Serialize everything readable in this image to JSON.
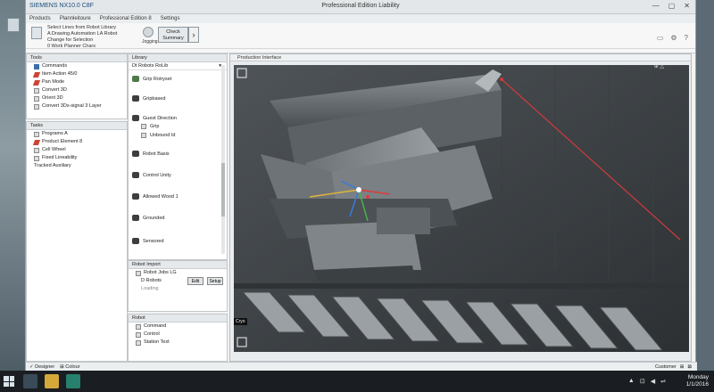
{
  "desktop": {
    "bezel_icon": "monitor-icon"
  },
  "window": {
    "brand": "SIEMENS NX10.0  C8F",
    "title": "Professional Edition Liability",
    "controls": [
      "—",
      "▢",
      "✕"
    ]
  },
  "menubar": {
    "items": [
      "Products",
      "Plannleitoure",
      "Professional Edition 8",
      "Settings"
    ]
  },
  "ribbon": {
    "lines": [
      "Select Lines from Robot Library",
      "A Drawing Automation LA Robot",
      "Change for Selection",
      "0 Work Planner Chars"
    ],
    "tool_label": "Jogging",
    "check_label_1": "Check",
    "check_label_2": "Summary",
    "arrow": "›",
    "right_icons": [
      "▭",
      "⚙",
      "?"
    ]
  },
  "tools": {
    "title": "Tools",
    "items": [
      {
        "label": "Commands",
        "icon": "blue"
      },
      {
        "label": "Item Action 45/0",
        "icon": "red"
      },
      {
        "label": "Pan Mode",
        "icon": "red"
      },
      {
        "label": "Convert 3D",
        "icon": "none"
      },
      {
        "label": "Orient 3D",
        "icon": "none"
      },
      {
        "label": "Convert 3Ds-signal 3 Layer",
        "icon": "none"
      }
    ]
  },
  "tasks": {
    "title": "Tasks",
    "items": [
      {
        "label": "Programs A",
        "icon": "folder"
      },
      {
        "label": "Product Element 8",
        "icon": "red"
      },
      {
        "label": "Cell Wheel",
        "icon": "box"
      },
      {
        "label": "Fixed Lineability",
        "icon": "box"
      },
      {
        "label": "Tracked Auxiliary",
        "icon": "none"
      }
    ]
  },
  "library": {
    "title": "Library",
    "tabs": [
      "Dt Robots RoLib",
      "▾"
    ],
    "items": [
      "Grip Rotryset",
      "Gripbased",
      "Guest Direction",
      "Grip",
      "Unbound Id",
      "Robot Basis",
      "Control Unity",
      "Allowed Wood 1",
      "Grounded",
      "Sensored"
    ]
  },
  "object": {
    "title": "Robot Import",
    "items": [
      "Robot Jobs LG",
      "D Robots",
      "Loading"
    ],
    "btn_edit": "Edit",
    "btn_setup": "Setup"
  },
  "props": {
    "title": "Robot",
    "items": [
      "Command",
      "Control",
      "Station Text"
    ]
  },
  "viewport": {
    "title": "Production Interface",
    "tag": "Cryo",
    "coord_readout": "⊕ △"
  },
  "status": {
    "left": [
      "✓ Designer",
      "⊞ Colour"
    ],
    "right": [
      "Customer",
      "⊞",
      "⊠"
    ]
  },
  "taskbar": {
    "tray": [
      "▲",
      "⊡",
      "◀",
      "⇌"
    ],
    "time": "Monday",
    "date": "1/1/2016"
  }
}
